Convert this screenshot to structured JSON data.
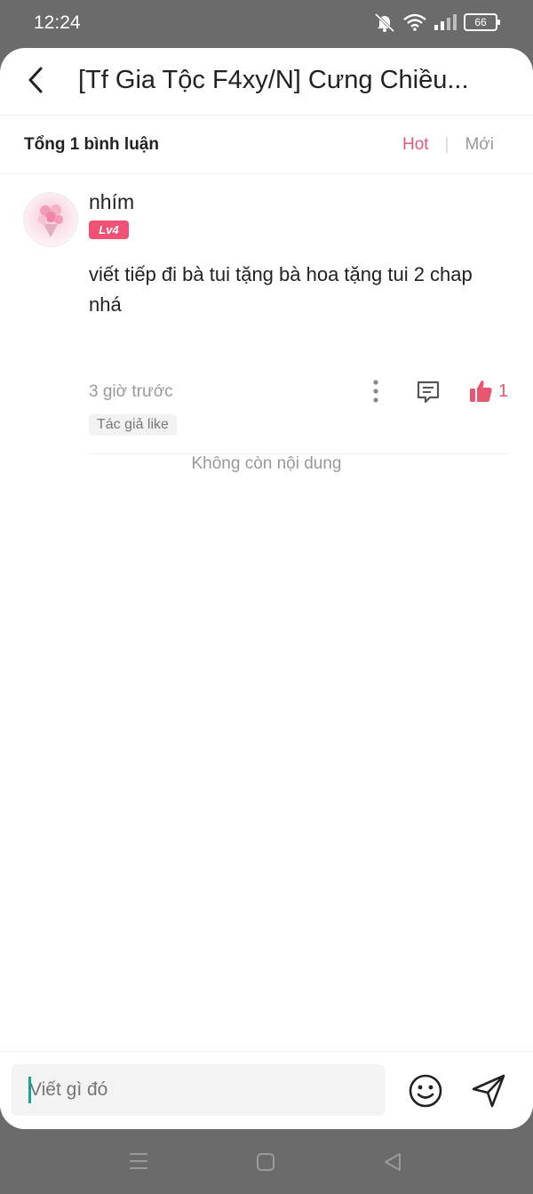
{
  "status_bar": {
    "time": "12:24",
    "battery": "66",
    "icons": [
      "mute-icon",
      "wifi-icon",
      "signal-icon",
      "battery-icon"
    ]
  },
  "header": {
    "title": "[Tf Gia Tộc F4xy/N] Cưng Chiều...",
    "back_icon": "chevron-left-icon"
  },
  "comments_bar": {
    "total_label": "Tổng 1 bình luận",
    "sort_hot": "Hot",
    "sort_separator": "|",
    "sort_new": "Mới"
  },
  "comment": {
    "username": "nhím",
    "level": "Lv4",
    "text": "viết tiếp đi bà tui tặng bà hoa tặng tui 2 chap nhá",
    "time": "3 giờ trước",
    "like_count": "1",
    "author_like_badge": "Tác giả like"
  },
  "end_message": "Không còn nội dung",
  "composer": {
    "placeholder": "Viết gì đó"
  },
  "colors": {
    "accent": "#e8566f",
    "level_badge": "#f05275",
    "overlay": "#6b6b6b"
  }
}
